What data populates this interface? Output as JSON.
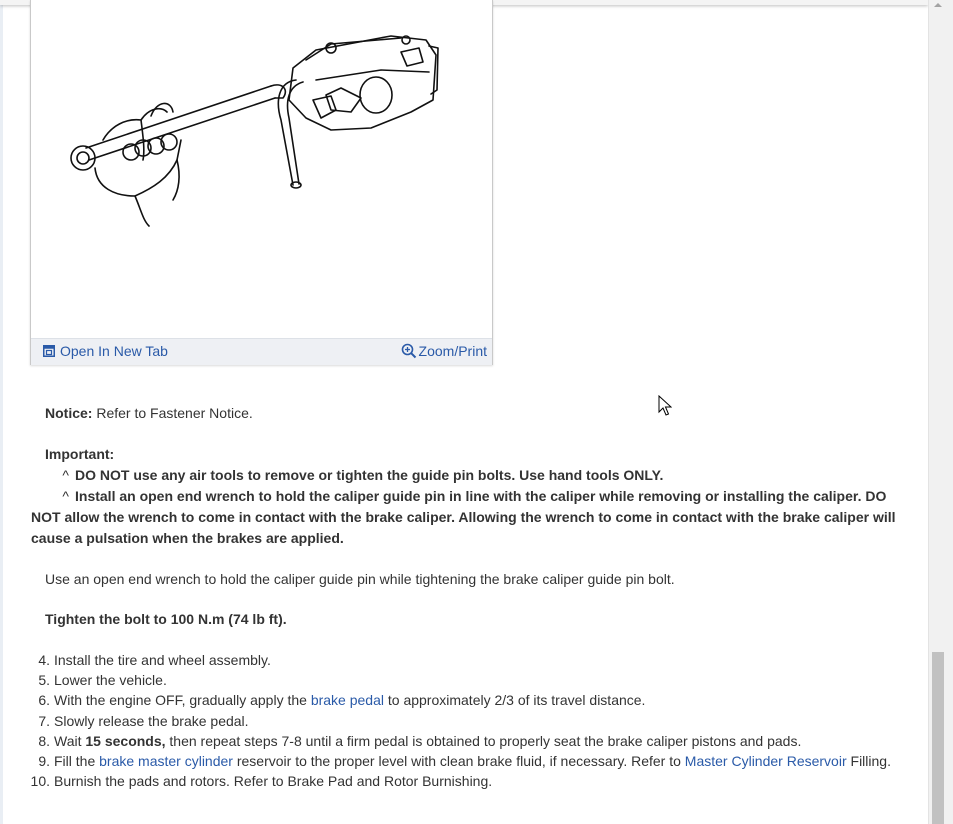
{
  "figure": {
    "open_in_new_tab": "Open In New Tab",
    "zoom_print": "Zoom/Print"
  },
  "notice": {
    "label": "Notice:",
    "text": " Refer to Fastener Notice."
  },
  "important": {
    "label": "Important:",
    "caret": "^",
    "bullet1": "DO NOT use any air tools to remove or tighten the guide pin bolts. Use hand tools ONLY.",
    "bullet2": "Install an open end wrench to hold the caliper guide pin in line with the caliper while removing or installing the caliper. DO NOT allow the wrench to come in contact with the brake caliper. Allowing the wrench to come in contact with the brake caliper will cause a pulsation when the brakes are applied."
  },
  "instruction": "Use an open end wrench to hold the caliper guide pin while tightening the brake caliper guide pin bolt.",
  "torque": "Tighten the bolt to 100 N.m (74 lb ft).",
  "steps": [
    {
      "num": "4.",
      "text": "Install the tire and wheel assembly."
    },
    {
      "num": "5.",
      "text": "Lower the vehicle."
    },
    {
      "num": "6.",
      "pre": "With the engine OFF, gradually apply the ",
      "link": "brake pedal",
      "post": " to approximately 2/3 of its travel distance."
    },
    {
      "num": "7.",
      "text": "Slowly release the brake pedal."
    },
    {
      "num": "8.",
      "pre": "Wait ",
      "bold": "15 seconds,",
      "post": " then repeat steps 7-8 until a firm pedal is obtained to properly seat the brake caliper pistons and pads."
    },
    {
      "num": "9.",
      "pre": "Fill the ",
      "link": "brake master cylinder",
      "mid": " reservoir to the proper level with clean brake fluid, if necessary. Refer to ",
      "link2": "Master Cylinder Reservoir",
      "post": " Filling."
    },
    {
      "num": "10.",
      "text": "Burnish the pads and rotors. Refer to Brake Pad and Rotor Burnishing."
    }
  ],
  "colors": {
    "link": "#2a5aa8",
    "text": "#333333"
  },
  "icons": {
    "open_tab": "open-in-new-tab-icon",
    "zoom": "zoom-magnifier-icon",
    "cursor": "mouse-pointer-icon"
  }
}
